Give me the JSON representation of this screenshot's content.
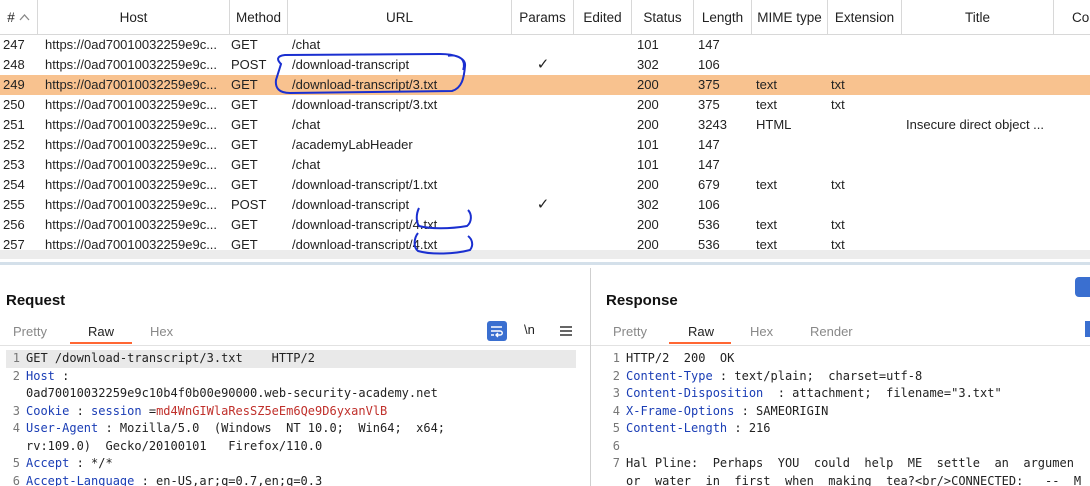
{
  "table": {
    "columns": [
      {
        "key": "num",
        "label": "#"
      },
      {
        "key": "host",
        "label": "Host"
      },
      {
        "key": "method",
        "label": "Method"
      },
      {
        "key": "url",
        "label": "URL"
      },
      {
        "key": "params",
        "label": "Params"
      },
      {
        "key": "edited",
        "label": "Edited"
      },
      {
        "key": "status",
        "label": "Status"
      },
      {
        "key": "length",
        "label": "Length"
      },
      {
        "key": "mime",
        "label": "MIME type"
      },
      {
        "key": "ext",
        "label": "Extension"
      },
      {
        "key": "title",
        "label": "Title"
      },
      {
        "key": "co",
        "label": "Co"
      }
    ],
    "rows": [
      {
        "num": "247",
        "host": "https://0ad70010032259e9c...",
        "method": "GET",
        "url": "/chat",
        "params": "",
        "edited": "",
        "status": "101",
        "length": "147",
        "mime": "",
        "ext": "",
        "title": ""
      },
      {
        "num": "248",
        "host": "https://0ad70010032259e9c...",
        "method": "POST",
        "url": "/download-transcript",
        "params": "✓",
        "edited": "",
        "status": "302",
        "length": "106",
        "mime": "",
        "ext": "",
        "title": ""
      },
      {
        "num": "249",
        "host": "https://0ad70010032259e9c...",
        "method": "GET",
        "url": "/download-transcript/3.txt",
        "params": "",
        "edited": "",
        "status": "200",
        "length": "375",
        "mime": "text",
        "ext": "txt",
        "title": "",
        "selected": true
      },
      {
        "num": "250",
        "host": "https://0ad70010032259e9c...",
        "method": "GET",
        "url": "/download-transcript/3.txt",
        "params": "",
        "edited": "",
        "status": "200",
        "length": "375",
        "mime": "text",
        "ext": "txt",
        "title": ""
      },
      {
        "num": "251",
        "host": "https://0ad70010032259e9c...",
        "method": "GET",
        "url": "/chat",
        "params": "",
        "edited": "",
        "status": "200",
        "length": "3243",
        "mime": "HTML",
        "ext": "",
        "title": "Insecure direct object ..."
      },
      {
        "num": "252",
        "host": "https://0ad70010032259e9c...",
        "method": "GET",
        "url": "/academyLabHeader",
        "params": "",
        "edited": "",
        "status": "101",
        "length": "147",
        "mime": "",
        "ext": "",
        "title": ""
      },
      {
        "num": "253",
        "host": "https://0ad70010032259e9c...",
        "method": "GET",
        "url": "/chat",
        "params": "",
        "edited": "",
        "status": "101",
        "length": "147",
        "mime": "",
        "ext": "",
        "title": ""
      },
      {
        "num": "254",
        "host": "https://0ad70010032259e9c...",
        "method": "GET",
        "url": "/download-transcript/1.txt",
        "params": "",
        "edited": "",
        "status": "200",
        "length": "679",
        "mime": "text",
        "ext": "txt",
        "title": ""
      },
      {
        "num": "255",
        "host": "https://0ad70010032259e9c...",
        "method": "POST",
        "url": "/download-transcript",
        "params": "✓",
        "edited": "",
        "status": "302",
        "length": "106",
        "mime": "",
        "ext": "",
        "title": ""
      },
      {
        "num": "256",
        "host": "https://0ad70010032259e9c...",
        "method": "GET",
        "url": "/download-transcript/4.txt",
        "params": "",
        "edited": "",
        "status": "200",
        "length": "536",
        "mime": "text",
        "ext": "txt",
        "title": ""
      },
      {
        "num": "257",
        "host": "https://0ad70010032259e9c...",
        "method": "GET",
        "url": "/download-transcript/4.txt",
        "params": "",
        "edited": "",
        "status": "200",
        "length": "536",
        "mime": "text",
        "ext": "txt",
        "title": ""
      }
    ]
  },
  "request": {
    "title": "Request",
    "tabs": [
      "Pretty",
      "Raw",
      "Hex"
    ],
    "active_tab": "Raw",
    "wrap_icon": "wrap-icon",
    "newline_label": "\\n",
    "menu_icon": "menu-icon",
    "lines": [
      {
        "n": "1",
        "parts": [
          {
            "t": "GET /download-transcript/3.txt    HTTP/2",
            "c": ""
          }
        ],
        "hl": true
      },
      {
        "n": "2",
        "parts": [
          {
            "t": "Host",
            "c": "hk"
          },
          {
            "t": " :",
            "c": ""
          }
        ]
      },
      {
        "n": "",
        "parts": [
          {
            "t": "0ad70010032259e9c10b4f0b00e90000.web-security-academy.net",
            "c": ""
          }
        ]
      },
      {
        "n": "3",
        "parts": [
          {
            "t": "Cookie",
            "c": "hk"
          },
          {
            "t": " : ",
            "c": ""
          },
          {
            "t": "session",
            "c": "hk"
          },
          {
            "t": " =",
            "c": ""
          },
          {
            "t": "md4WnGIWlaResSZ5eEm6Qe9D6yxanVlB",
            "c": "cv"
          }
        ]
      },
      {
        "n": "4",
        "parts": [
          {
            "t": "User-Agent",
            "c": "hk"
          },
          {
            "t": " : Mozilla/5.0  (Windows  NT 10.0;  Win64;  x64;",
            "c": ""
          }
        ]
      },
      {
        "n": "",
        "parts": [
          {
            "t": "rv:109.0)  Gecko/20100101   Firefox/110.0",
            "c": ""
          }
        ]
      },
      {
        "n": "5",
        "parts": [
          {
            "t": "Accept",
            "c": "hk"
          },
          {
            "t": " : */*",
            "c": ""
          }
        ]
      },
      {
        "n": "6",
        "parts": [
          {
            "t": "Accept-Language",
            "c": "hk"
          },
          {
            "t": " : en-US,ar;q=0.7,en;q=0.3",
            "c": ""
          }
        ]
      }
    ]
  },
  "response": {
    "title": "Response",
    "tabs": [
      "Pretty",
      "Raw",
      "Hex",
      "Render"
    ],
    "active_tab": "Raw",
    "lines": [
      {
        "n": "1",
        "parts": [
          {
            "t": "HTTP/2  200  OK",
            "c": ""
          }
        ]
      },
      {
        "n": "2",
        "parts": [
          {
            "t": "Content-Type",
            "c": "hk"
          },
          {
            "t": " : text/plain;  charset=utf-8",
            "c": ""
          }
        ]
      },
      {
        "n": "3",
        "parts": [
          {
            "t": "Content-Disposition",
            "c": "hk"
          },
          {
            "t": "  : attachment;  filename=\"3.txt\"",
            "c": ""
          }
        ]
      },
      {
        "n": "4",
        "parts": [
          {
            "t": "X-Frame-Options",
            "c": "hk"
          },
          {
            "t": " : SAMEORIGIN",
            "c": ""
          }
        ]
      },
      {
        "n": "5",
        "parts": [
          {
            "t": "Content-Length",
            "c": "hk"
          },
          {
            "t": " : 216",
            "c": ""
          }
        ]
      },
      {
        "n": "6",
        "parts": [
          {
            "t": "",
            "c": ""
          }
        ]
      },
      {
        "n": "7",
        "parts": [
          {
            "t": "Hal Pline:  Perhaps  YOU  could  help  ME  settle  an  argumen",
            "c": ""
          }
        ]
      },
      {
        "n": "",
        "parts": [
          {
            "t": "or  water  in  first  when  making  tea?<br/>CONNECTED:   --  M",
            "c": ""
          }
        ]
      }
    ]
  },
  "colors": {
    "selected_row": "#f8c28f",
    "tab_accent": "#ff6633",
    "header_key": "#1a3db5",
    "cookie_value": "#c0302b",
    "annotation_ink": "#1a2fd0",
    "action_button": "#3a6fd0"
  }
}
